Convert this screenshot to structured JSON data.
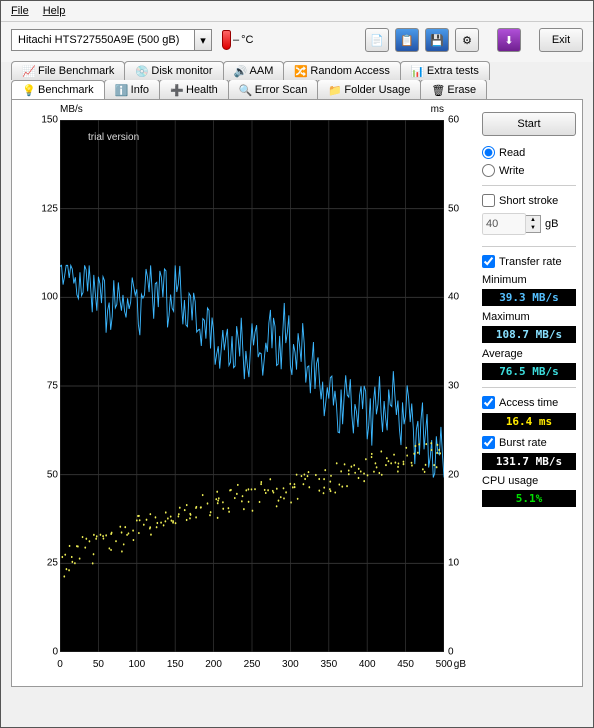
{
  "menu": {
    "file_label": "File",
    "help_label": "Help"
  },
  "toolbar": {
    "drive_label": "Hitachi HTS727550A9E   (500 gB)",
    "temp_prefix": "–",
    "temp_unit": "°C",
    "exit_label": "Exit"
  },
  "tabs_upper": [
    {
      "label": "File Benchmark"
    },
    {
      "label": "Disk monitor"
    },
    {
      "label": "AAM"
    },
    {
      "label": "Random Access"
    },
    {
      "label": "Extra tests"
    }
  ],
  "tabs_lower": [
    {
      "label": "Benchmark",
      "active": true
    },
    {
      "label": "Info"
    },
    {
      "label": "Health"
    },
    {
      "label": "Error Scan"
    },
    {
      "label": "Folder Usage"
    },
    {
      "label": "Erase"
    }
  ],
  "right": {
    "start_label": "Start",
    "read_label": "Read",
    "write_label": "Write",
    "short_stroke_label": "Short stroke",
    "short_stroke_value": "40",
    "short_stroke_unit": "gB",
    "transfer_rate_label": "Transfer rate",
    "min_label": "Minimum",
    "min_value": "39.3 MB/s",
    "max_label": "Maximum",
    "max_value": "108.7 MB/s",
    "avg_label": "Average",
    "avg_value": "76.5 MB/s",
    "access_label": "Access time",
    "access_value": "16.4 ms",
    "burst_label": "Burst rate",
    "burst_value": "131.7 MB/s",
    "cpu_label": "CPU usage",
    "cpu_value": "5.1%"
  },
  "axes": {
    "y_left_unit": "MB/s",
    "y_right_unit": "ms",
    "x_unit": "gB",
    "watermark": "trial version",
    "y_left_ticks": [
      150,
      125,
      100,
      75,
      50,
      25,
      0
    ],
    "y_right_ticks": [
      60,
      50,
      40,
      30,
      20,
      10,
      0
    ],
    "x_ticks": [
      0,
      50,
      100,
      150,
      200,
      250,
      300,
      350,
      400,
      450,
      500
    ]
  },
  "chart_data": {
    "type": "line",
    "title": "",
    "x_range": [
      0,
      500
    ],
    "x_unit": "gB",
    "left_axis": {
      "label": "MB/s",
      "range": [
        0,
        150
      ]
    },
    "right_axis": {
      "label": "ms",
      "range": [
        0,
        60
      ]
    },
    "series": [
      {
        "name": "Transfer rate",
        "axis": "left",
        "color": "#3cb8ff",
        "style": "line",
        "x": [
          0,
          10,
          20,
          30,
          40,
          50,
          60,
          70,
          80,
          90,
          100,
          110,
          120,
          130,
          140,
          150,
          160,
          170,
          180,
          190,
          200,
          210,
          220,
          230,
          240,
          250,
          260,
          270,
          280,
          290,
          300,
          310,
          320,
          330,
          340,
          350,
          360,
          370,
          380,
          390,
          400,
          410,
          420,
          430,
          440,
          450,
          460,
          470,
          480,
          490,
          500
        ],
        "y": [
          104,
          107,
          101,
          106,
          103,
          108,
          99,
          105,
          100,
          104,
          96,
          102,
          96,
          100,
          93,
          99,
          92,
          97,
          90,
          96,
          88,
          93,
          86,
          92,
          84,
          90,
          82,
          88,
          80,
          86,
          78,
          84,
          76,
          82,
          74,
          80,
          72,
          78,
          70,
          74,
          66,
          71,
          63,
          68,
          60,
          65,
          57,
          62,
          55,
          60,
          54
        ]
      },
      {
        "name": "Transfer rate noise band",
        "axis": "left",
        "color": "#3cb8ff",
        "style": "noise",
        "amplitude": 8,
        "min": 39.3,
        "max": 108.7,
        "avg": 76.5
      },
      {
        "name": "Access time",
        "axis": "right",
        "color": "#eeee55",
        "style": "scatter",
        "avg_ms": 16.4,
        "x": [
          5,
          12,
          18,
          24,
          33,
          41,
          48,
          56,
          63,
          70,
          77,
          84,
          92,
          99,
          106,
          114,
          121,
          128,
          136,
          143,
          150,
          158,
          165,
          172,
          180,
          187,
          194,
          202,
          209,
          216,
          224,
          231,
          238,
          246,
          253,
          260,
          268,
          275,
          282,
          290,
          297,
          304,
          312,
          319,
          326,
          334,
          341,
          348,
          356,
          363,
          370,
          378,
          385,
          392,
          400,
          407,
          414,
          422,
          429,
          436,
          444,
          451,
          458,
          466,
          473,
          480,
          488,
          495
        ],
        "y": [
          10,
          10.5,
          11,
          10.8,
          11.5,
          11.2,
          12,
          12.5,
          12.2,
          13,
          12.8,
          13.5,
          13.2,
          14,
          13.8,
          14.5,
          14.2,
          15,
          14.8,
          15.5,
          15.2,
          16,
          15.6,
          16.3,
          15.9,
          16.6,
          16.2,
          17,
          16.5,
          17.2,
          16.8,
          17.5,
          17,
          17.8,
          17.3,
          18,
          17.6,
          18.3,
          17.9,
          18.6,
          18.2,
          18.9,
          18.5,
          19.2,
          18.8,
          19.5,
          19.1,
          19.8,
          19.4,
          20.1,
          19.7,
          20.4,
          20,
          20.7,
          20.3,
          21,
          20.6,
          21.3,
          20.9,
          21.6,
          21.2,
          21.9,
          21.5,
          22.2,
          21.8,
          22.5,
          22.1,
          22.8
        ]
      }
    ]
  }
}
